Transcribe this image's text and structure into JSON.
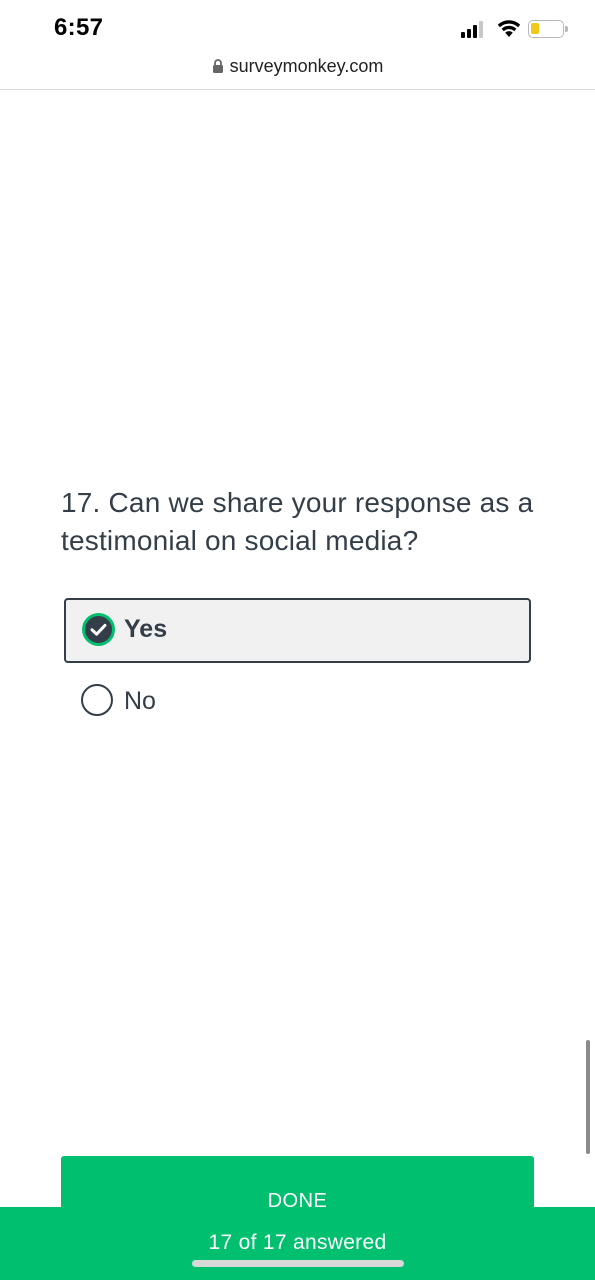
{
  "status_bar": {
    "time": "6:57",
    "icons": [
      "cellular-signal-icon",
      "wifi-icon",
      "battery-icon"
    ],
    "battery_color": "#f2c81b"
  },
  "browser": {
    "url": "surveymonkey.com",
    "lock_icon": "lock-icon"
  },
  "question": {
    "text": "17. Can we share your response as a testimonial on social media?",
    "options": [
      {
        "label": "Yes",
        "selected": true
      },
      {
        "label": "No",
        "selected": false
      }
    ]
  },
  "footer": {
    "done_label": "DONE",
    "progress_text": "17 of 17 answered"
  },
  "colors": {
    "accent": "#00bf6f",
    "text": "#333e48",
    "selected_bg": "#f1f1f1"
  }
}
